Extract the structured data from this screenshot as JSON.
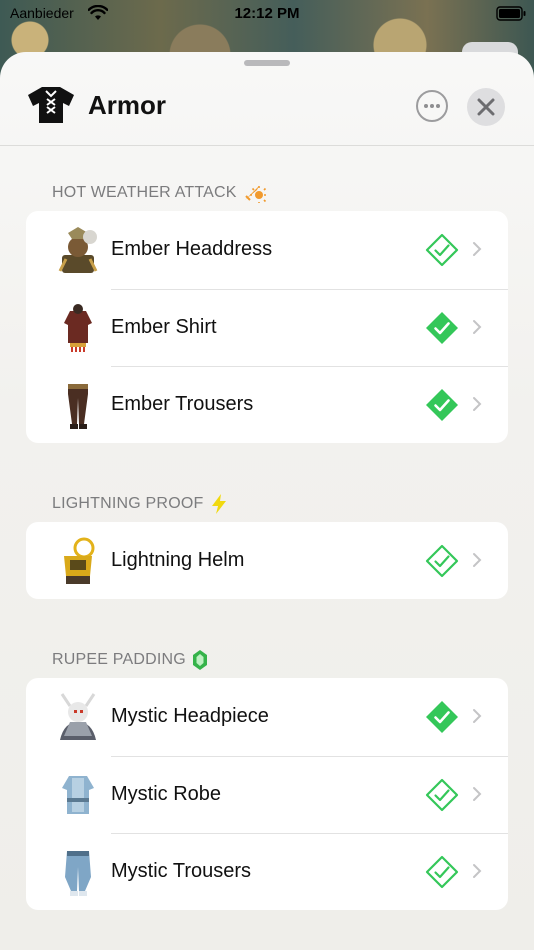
{
  "status_bar": {
    "carrier": "Aanbieder",
    "time": "12:12 PM"
  },
  "header": {
    "title": "Armor",
    "icon": "tunic-icon"
  },
  "sections": [
    {
      "title": "HOT WEATHER ATTACK",
      "icon": "sword-sun-icon",
      "items": [
        {
          "label": "Ember Headdress",
          "status": "outline"
        },
        {
          "label": "Ember Shirt",
          "status": "filled"
        },
        {
          "label": "Ember Trousers",
          "status": "filled"
        }
      ]
    },
    {
      "title": "LIGHTNING PROOF",
      "icon": "lightning-bolt-icon",
      "items": [
        {
          "label": "Lightning Helm",
          "status": "outline"
        }
      ]
    },
    {
      "title": "RUPEE PADDING",
      "icon": "rupee-icon",
      "items": [
        {
          "label": "Mystic Headpiece",
          "status": "filled"
        },
        {
          "label": "Mystic Robe",
          "status": "outline"
        },
        {
          "label": "Mystic Trousers",
          "status": "outline"
        }
      ]
    }
  ],
  "colors": {
    "check_green": "#34c759",
    "section_text": "#7c7c7e",
    "bolt_yellow": "#f1d90f",
    "rupee_green": "#35b34a",
    "sword_orange": "#f19a2d"
  }
}
